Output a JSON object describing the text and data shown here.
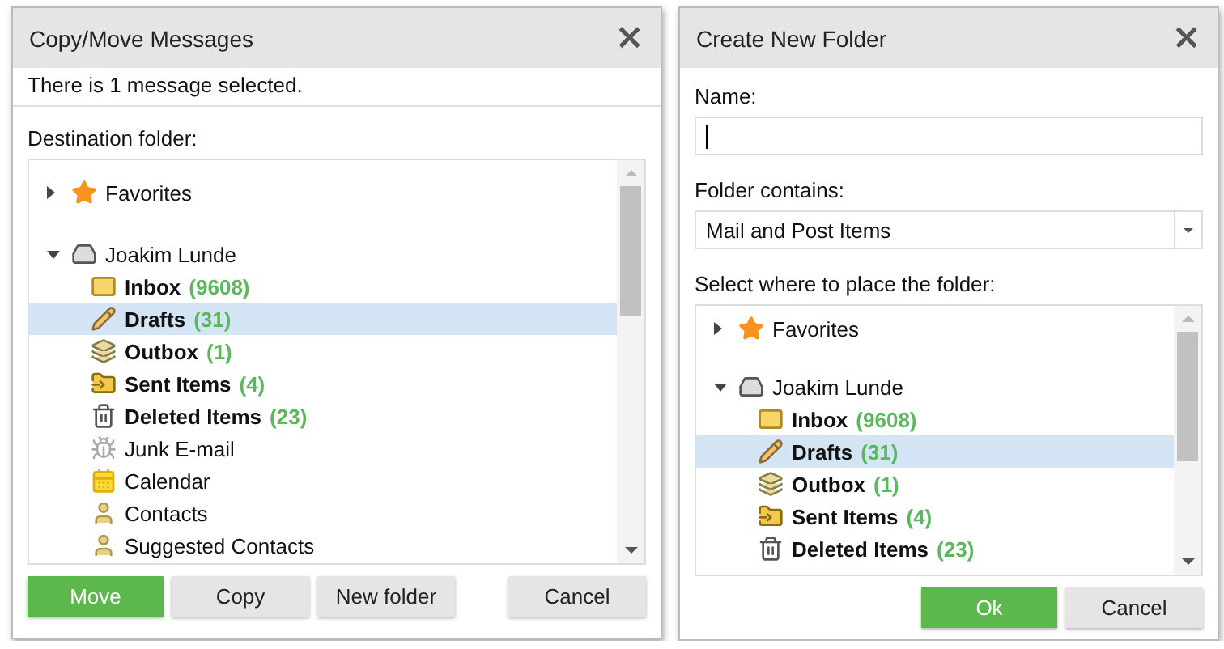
{
  "copy_move_dialog": {
    "title": "Copy/Move Messages",
    "close": "×",
    "info": "There is 1 message selected.",
    "tree_label": "Destination folder:",
    "tree": [
      {
        "kind": "favorites",
        "label": "Favorites",
        "expanded": false
      },
      {
        "kind": "account",
        "label": "Joakim Lunde",
        "expanded": true,
        "children": [
          {
            "kind": "inbox",
            "label": "Inbox",
            "count": "(9608)",
            "bold": true,
            "selected": false
          },
          {
            "kind": "drafts",
            "label": "Drafts",
            "count": "(31)",
            "bold": true,
            "selected": true
          },
          {
            "kind": "outbox",
            "label": "Outbox",
            "count": "(1)",
            "bold": true,
            "selected": false
          },
          {
            "kind": "sent",
            "label": "Sent Items",
            "count": "(4)",
            "bold": true,
            "selected": false
          },
          {
            "kind": "deleted",
            "label": "Deleted Items",
            "count": "(23)",
            "bold": true,
            "selected": false
          },
          {
            "kind": "junk",
            "label": "Junk E-mail",
            "bold": false,
            "selected": false
          },
          {
            "kind": "calendar",
            "label": "Calendar",
            "bold": false,
            "selected": false
          },
          {
            "kind": "contacts",
            "label": "Contacts",
            "bold": false,
            "selected": false
          },
          {
            "kind": "contacts",
            "label": "Suggested Contacts",
            "bold": false,
            "selected": false
          }
        ]
      }
    ],
    "buttons": [
      {
        "label": "Move",
        "kind": "primary"
      },
      {
        "label": "Copy",
        "kind": "default"
      },
      {
        "label": "New folder",
        "kind": "default"
      },
      {
        "label": "Cancel",
        "kind": "cancel"
      }
    ]
  },
  "create_folder_dialog": {
    "title": "Create New Folder",
    "close": "×",
    "name_label": "Name:",
    "folder_contains_label": "Folder contains:",
    "folder_contains_value": "Mail and Post Items",
    "place_label": "Select where to place the folder:",
    "tree": [
      {
        "kind": "favorites",
        "label": "Favorites",
        "expanded": false
      },
      {
        "kind": "account",
        "label": "Joakim Lunde",
        "expanded": true,
        "children": [
          {
            "kind": "inbox",
            "label": "Inbox",
            "count": "(9608)",
            "bold": true,
            "selected": false
          },
          {
            "kind": "drafts",
            "label": "Drafts",
            "count": "(31)",
            "bold": true,
            "selected": true
          },
          {
            "kind": "outbox",
            "label": "Outbox",
            "count": "(1)",
            "bold": true,
            "selected": false
          },
          {
            "kind": "sent",
            "label": "Sent Items",
            "count": "(4)",
            "bold": true,
            "selected": false
          },
          {
            "kind": "deleted",
            "label": "Deleted Items",
            "count": "(23)",
            "bold": true,
            "selected": false
          }
        ]
      }
    ],
    "buttons": [
      {
        "label": "Ok",
        "kind": "primary"
      },
      {
        "label": "Cancel",
        "kind": "default"
      }
    ]
  }
}
